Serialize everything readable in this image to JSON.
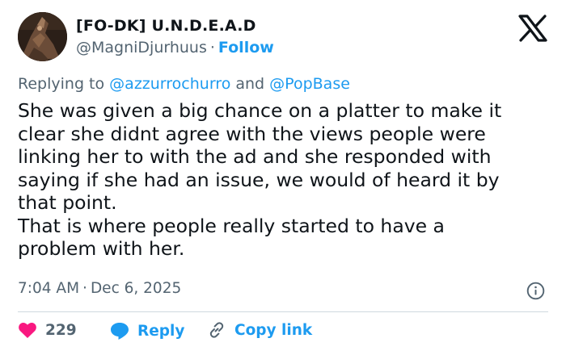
{
  "author": {
    "display_name": "[FO-DK] U.N.D.E.A.D",
    "handle": "@MagniDjurhuus",
    "separator": "·",
    "follow_label": "Follow"
  },
  "brand": {
    "logo_icon": "x-logo-icon"
  },
  "reply_context": {
    "prefix": "Replying to",
    "mention_1": "@azzurrochurro",
    "conjunction": "and",
    "mention_2": "@PopBase"
  },
  "tweet": {
    "lines": [
      "She was given a big chance on a platter to make it",
      "clear she didnt agree with the views people were",
      "linking her to with the ad and she responded with",
      "saying if she had an issue, we would of heard it by",
      "that point.",
      "That is where people really started to have a",
      "problem with her."
    ],
    "time": "7:04 AM",
    "separator": "·",
    "date": "Dec 6, 2025"
  },
  "actions": {
    "like_count": "229",
    "reply_label": "Reply",
    "copy_label": "Copy link"
  },
  "colors": {
    "accent": "#1d9bf0",
    "like": "#f91880",
    "text": "#0f1419",
    "secondary": "#536471",
    "divider": "#cfd9de"
  }
}
